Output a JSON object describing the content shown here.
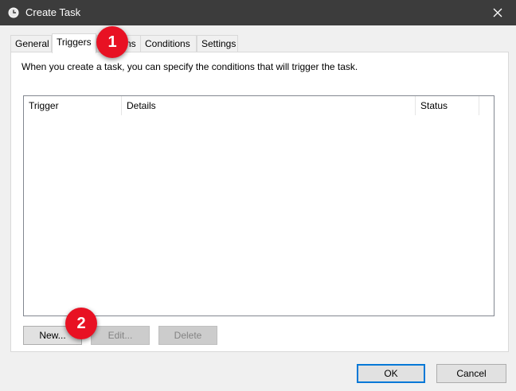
{
  "window": {
    "title": "Create Task",
    "close_icon": "close-icon",
    "app_icon": "task-scheduler-clock-icon"
  },
  "tabs": [
    {
      "label": "General",
      "active": false
    },
    {
      "label": "Triggers",
      "active": true
    },
    {
      "label": "ns",
      "active": false
    },
    {
      "label": "Conditions",
      "active": false
    },
    {
      "label": "Settings",
      "active": false
    }
  ],
  "triggers": {
    "description": "When you create a task, you can specify the conditions that will trigger the task.",
    "columns": [
      "Trigger",
      "Details",
      "Status"
    ],
    "rows": [],
    "new_label": "New...",
    "edit_label": "Edit...",
    "delete_label": "Delete"
  },
  "footer": {
    "ok_label": "OK",
    "cancel_label": "Cancel"
  },
  "callouts": [
    {
      "number": "1",
      "color": "#e81123"
    },
    {
      "number": "2",
      "color": "#e81123"
    }
  ]
}
